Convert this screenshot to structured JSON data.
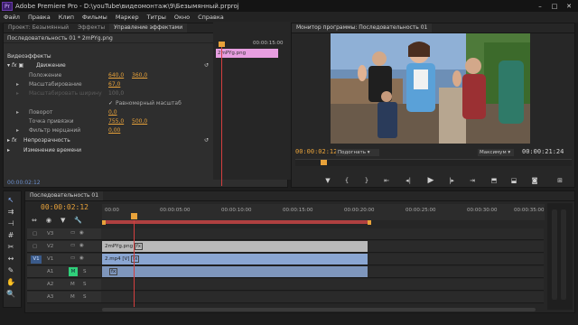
{
  "window": {
    "title": "Adobe Premiere Pro - D:\\youTube\\видеомонтаж\\9\\Безымянный.prproj",
    "logo": "Pr"
  },
  "menu": [
    "Файл",
    "Правка",
    "Клип",
    "Фильмы",
    "Маркер",
    "Титры",
    "Окно",
    "Справка"
  ],
  "left_tabs": [
    "Проект: Безымянный",
    "Эффекты",
    "Управление эффектами"
  ],
  "effects": {
    "header": "Последовательность 01 * 2mPYg.png",
    "ruler_time": "00:00:15:00",
    "clip_label": "2mPYg.png",
    "section_label": "Видеоэффекты",
    "motion": "Движение",
    "position_label": "Положение",
    "position_x": "640,0",
    "position_y": "360,0",
    "scale_label": "Масштабирование",
    "scale_val": "67,0",
    "scale_width_label": "Масштабировать ширину",
    "scale_width_val": "100,0",
    "uniform_label": "Равномерный масштаб",
    "rotation_label": "Поворот",
    "rotation_val": "0,0",
    "anchor_label": "Точка привязки",
    "anchor_x": "755,0",
    "anchor_y": "500,0",
    "flicker_label": "Фильтр мерцаний",
    "flicker_val": "0,00",
    "opacity": "Непрозрачность",
    "time_remap": "Изменение времени",
    "footer_time": "00:00:02:12"
  },
  "monitor": {
    "tab": "Монитор программы: Последовательность 01",
    "timecode": "00:00:02:12",
    "fit": "Подогнать",
    "quality": "Максимум",
    "duration": "00:00:21:24"
  },
  "timeline": {
    "tab": "Последовательность 01",
    "timecode": "00:00:02:12",
    "ruler": [
      "00:00",
      "00:00:05:00",
      "00:00:10:00",
      "00:00:15:00",
      "00:00:20:00",
      "00:00:25:00",
      "00:00:30:00",
      "00:00:35:00"
    ],
    "tracks": [
      {
        "id": "V3",
        "label": "V3"
      },
      {
        "id": "V2",
        "label": "V2"
      },
      {
        "id": "V1",
        "label": "V1",
        "src": "V1"
      },
      {
        "id": "A1",
        "label": "A1",
        "m": "M",
        "s": "S"
      },
      {
        "id": "A2",
        "label": "A2",
        "m": "M",
        "s": "S"
      },
      {
        "id": "A3",
        "label": "A3",
        "m": "M",
        "s": "S"
      }
    ],
    "clip_v2": "2mPYg.png",
    "clip_v1": "2.mp4 [V]",
    "clip_a1": ""
  }
}
